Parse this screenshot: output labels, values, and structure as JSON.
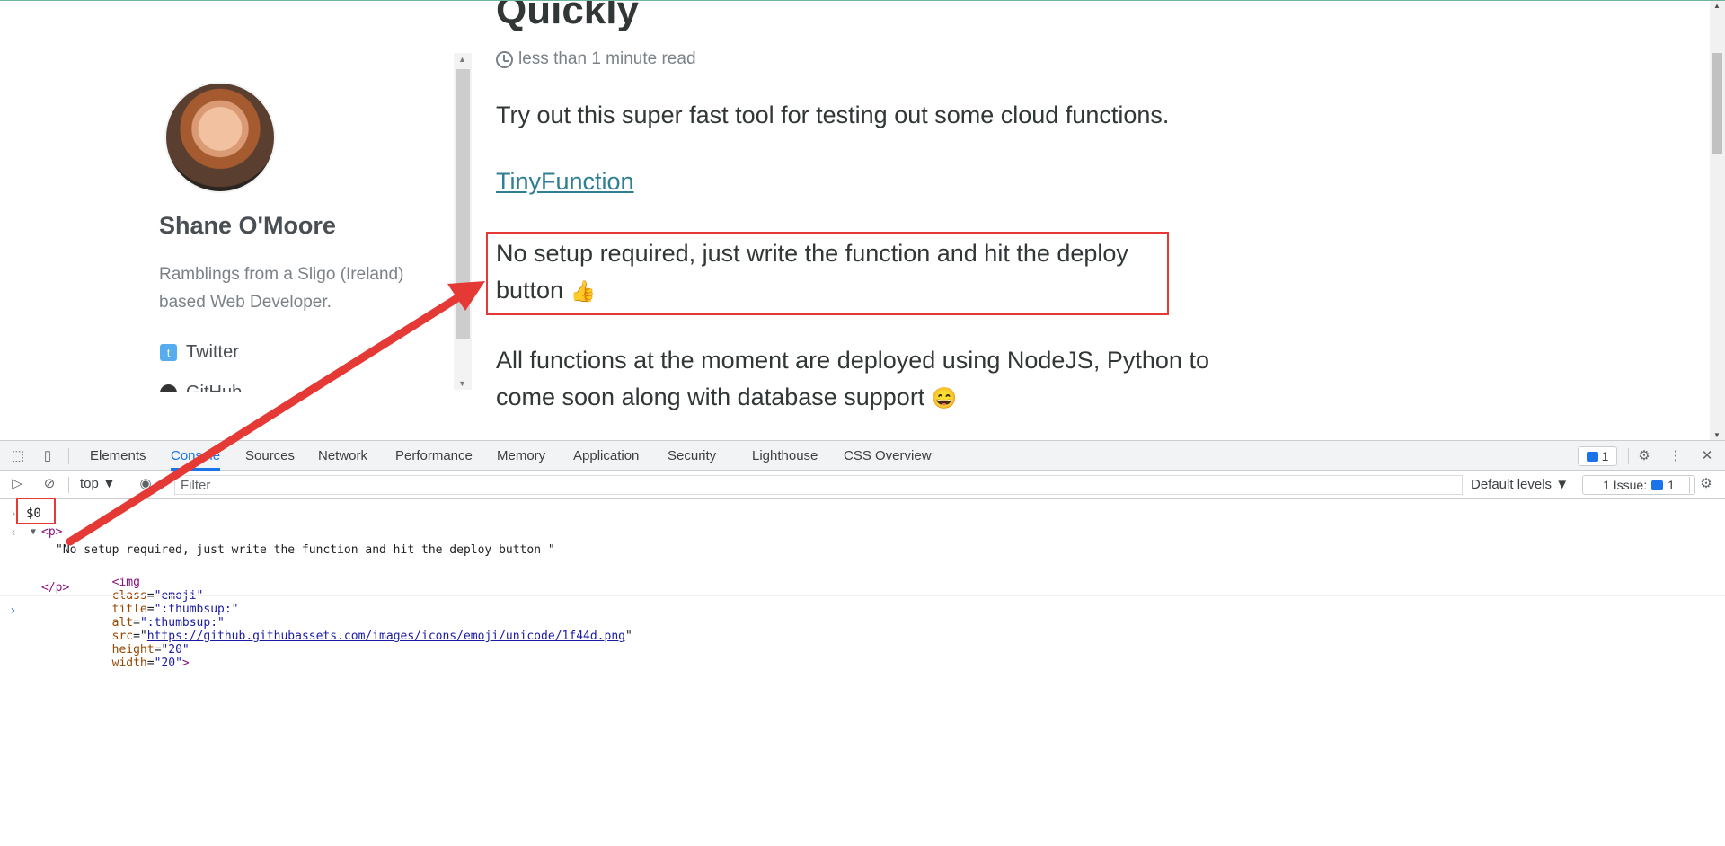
{
  "page": {
    "post_title": "Quickly",
    "read_time": "less than 1 minute read",
    "intro": "Try out this super fast tool for testing out some cloud functions.",
    "link_text": "TinyFunction",
    "highlight_text": "No setup required, just write the function and hit the deploy button",
    "highlight_emoji": "👍",
    "node_text": "All functions at the moment are deployed using NodeJS, Python to come soon along with database support",
    "node_emoji": "😄"
  },
  "sidebar": {
    "author_name": "Shane O'Moore",
    "author_bio": "Ramblings from a Sligo (Ireland) based Web Developer.",
    "social": [
      {
        "label": "Twitter",
        "icon": "twitter-icon"
      },
      {
        "label": "GitHub",
        "icon": "github-icon"
      }
    ]
  },
  "devtools": {
    "tabs": [
      "Elements",
      "Console",
      "Sources",
      "Network",
      "Performance",
      "Memory",
      "Application",
      "Security",
      "Lighthouse",
      "CSS Overview"
    ],
    "active_tab": "Console",
    "issues_count": "1",
    "context": "top",
    "filter_placeholder": "Filter",
    "levels": "Default levels",
    "issues_label": "1 Issue:",
    "issues_btn_count": "1"
  },
  "console": {
    "input_expr": "$0",
    "open_tag": "<p>",
    "text_node": "\"No setup required, just write the function and hit the deploy button \"",
    "img_tag_open": "<img",
    "img_class_attr": "class",
    "img_class_val": "\"emoji\"",
    "img_title_attr": "title",
    "img_title_val": "\":thumbsup:\"",
    "img_alt_attr": "alt",
    "img_alt_val": "\":thumbsup:\"",
    "img_src_attr": "src",
    "img_src_val": "https://github.githubassets.com/images/icons/emoji/unicode/1f44d.png",
    "img_height_attr": "height",
    "img_height_val": "\"20\"",
    "img_width_attr": "width",
    "img_width_val": "\"20\"",
    "close_tag": "</p>"
  },
  "colors": {
    "annotation": "#e53935",
    "accent": "#1a73e8",
    "link": "#2f7f93"
  }
}
